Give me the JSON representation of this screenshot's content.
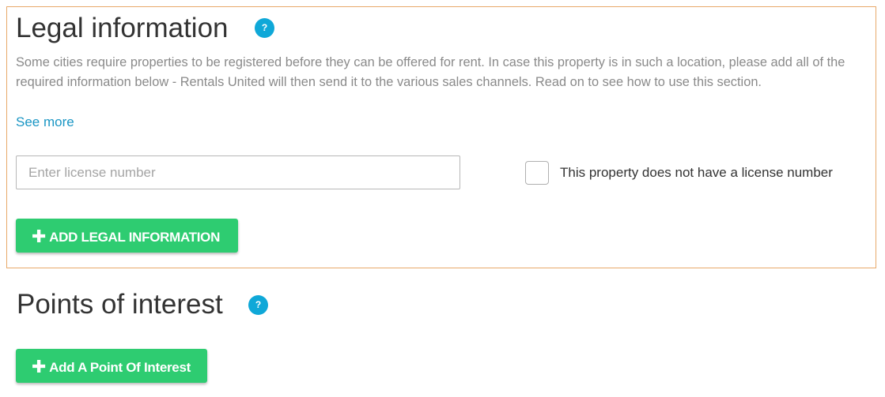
{
  "legal": {
    "title": "Legal information",
    "help": "?",
    "description": "Some cities require properties to be registered before they can be offered for rent. In case this property is in such a location, please add all of the required information below - Rentals United will then send it to the various sales channels. Read on to see how to use this section.",
    "see_more": "See more",
    "license_placeholder": "Enter license number",
    "license_value": "",
    "no_license_label": "This property does not have a license number",
    "no_license_checked": false,
    "add_button_label": "ADD LEGAL INFORMATION"
  },
  "poi": {
    "title": "Points of interest",
    "help": "?",
    "add_button_label": "Add A Point Of Interest"
  },
  "icons": {
    "help": "question-mark-circle",
    "plus": "plus"
  },
  "colors": {
    "accent_green": "#2ecc71",
    "help_blue": "#0fa8d8",
    "link_blue": "#1a96c4",
    "panel_border": "#e8a96a"
  }
}
